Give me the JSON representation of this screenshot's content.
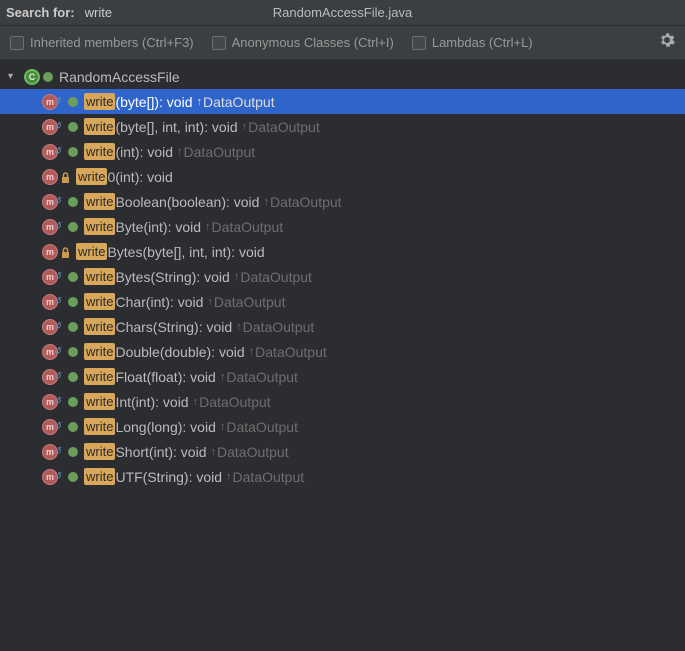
{
  "header": {
    "searchLabel": "Search for:",
    "searchValue": "write",
    "title": "RandomAccessFile.java"
  },
  "filters": {
    "inherited": "Inherited members (Ctrl+F3)",
    "anonymous": "Anonymous Classes (Ctrl+I)",
    "lambdas": "Lambdas (Ctrl+L)"
  },
  "className": "RandomAccessFile",
  "methods": [
    {
      "hl": "write",
      "sig": "(byte[]): void",
      "inherit": "DataOutput",
      "selected": true,
      "override": true,
      "vis": "public"
    },
    {
      "hl": "write",
      "sig": "(byte[], int, int): void",
      "inherit": "DataOutput",
      "override": true,
      "vis": "public"
    },
    {
      "hl": "write",
      "sig": "(int): void",
      "inherit": "DataOutput",
      "override": true,
      "vis": "public"
    },
    {
      "hl": "write",
      "sig": "0(int): void",
      "inherit": "",
      "override": false,
      "vis": "private"
    },
    {
      "hl": "write",
      "sig": "Boolean(boolean): void",
      "inherit": "DataOutput",
      "override": true,
      "vis": "public"
    },
    {
      "hl": "write",
      "sig": "Byte(int): void",
      "inherit": "DataOutput",
      "override": true,
      "vis": "public"
    },
    {
      "hl": "write",
      "sig": "Bytes(byte[], int, int): void",
      "inherit": "",
      "override": false,
      "vis": "private"
    },
    {
      "hl": "write",
      "sig": "Bytes(String): void",
      "inherit": "DataOutput",
      "override": true,
      "vis": "public"
    },
    {
      "hl": "write",
      "sig": "Char(int): void",
      "inherit": "DataOutput",
      "override": true,
      "vis": "public"
    },
    {
      "hl": "write",
      "sig": "Chars(String): void",
      "inherit": "DataOutput",
      "override": true,
      "vis": "public"
    },
    {
      "hl": "write",
      "sig": "Double(double): void",
      "inherit": "DataOutput",
      "override": true,
      "vis": "public"
    },
    {
      "hl": "write",
      "sig": "Float(float): void",
      "inherit": "DataOutput",
      "override": true,
      "vis": "public"
    },
    {
      "hl": "write",
      "sig": "Int(int): void",
      "inherit": "DataOutput",
      "override": true,
      "vis": "public"
    },
    {
      "hl": "write",
      "sig": "Long(long): void",
      "inherit": "DataOutput",
      "override": true,
      "vis": "public"
    },
    {
      "hl": "write",
      "sig": "Short(int): void",
      "inherit": "DataOutput",
      "override": true,
      "vis": "public"
    },
    {
      "hl": "write",
      "sig": "UTF(String): void",
      "inherit": "DataOutput",
      "override": true,
      "vis": "public"
    }
  ]
}
